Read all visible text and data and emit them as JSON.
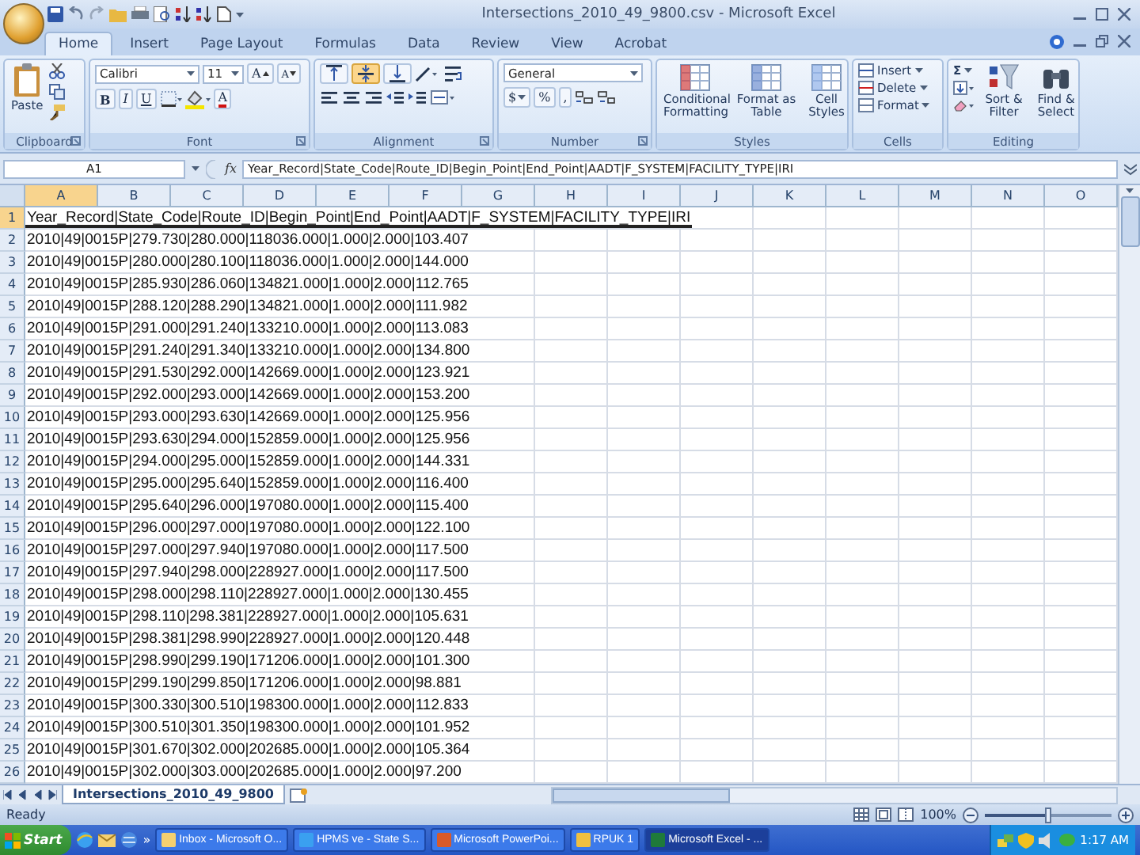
{
  "window": {
    "title": "Intersections_2010_49_9800.csv - Microsoft Excel"
  },
  "tabs": [
    {
      "label": "Home",
      "selected": true
    },
    {
      "label": "Insert",
      "selected": false
    },
    {
      "label": "Page Layout",
      "selected": false
    },
    {
      "label": "Formulas",
      "selected": false
    },
    {
      "label": "Data",
      "selected": false
    },
    {
      "label": "Review",
      "selected": false
    },
    {
      "label": "View",
      "selected": false
    },
    {
      "label": "Acrobat",
      "selected": false
    }
  ],
  "ribbon": {
    "clipboard": {
      "label": "Clipboard",
      "paste": "Paste"
    },
    "font": {
      "label": "Font",
      "name": "Calibri",
      "size": "11",
      "grow": "A",
      "shrink": "A",
      "bold": "B",
      "italic": "I",
      "underline": "U",
      "font_color_label": "A"
    },
    "alignment": {
      "label": "Alignment",
      "vertical_align": [
        {
          "selected": false
        },
        {
          "selected": true
        },
        {
          "selected": false
        }
      ]
    },
    "number": {
      "label": "Number",
      "format": "General",
      "currency": "$",
      "percent": "%",
      "comma": ","
    },
    "styles": {
      "label": "Styles",
      "buttons": [
        "Conditional Formatting",
        "Format as Table",
        "Cell Styles"
      ]
    },
    "cells": {
      "label": "Cells",
      "buttons": [
        "Insert",
        "Delete",
        "Format"
      ]
    },
    "editing": {
      "label": "Editing",
      "sum": "Σ",
      "buttons": [
        "Sort & Filter",
        "Find & Select"
      ]
    }
  },
  "formula_bar": {
    "name_box": "A1",
    "function_label": "fx",
    "formula": "Year_Record|State_Code|Route_ID|Begin_Point|End_Point|AADT|F_SYSTEM|FACILITY_TYPE|IRI"
  },
  "columns": [
    {
      "label": "A",
      "selected": true
    },
    {
      "label": "B",
      "selected": false
    },
    {
      "label": "C",
      "selected": false
    },
    {
      "label": "D",
      "selected": false
    },
    {
      "label": "E",
      "selected": false
    },
    {
      "label": "F",
      "selected": false
    },
    {
      "label": "G",
      "selected": false
    },
    {
      "label": "H",
      "selected": false
    },
    {
      "label": "I",
      "selected": false
    },
    {
      "label": "J",
      "selected": false
    },
    {
      "label": "K",
      "selected": false
    },
    {
      "label": "L",
      "selected": false
    },
    {
      "label": "M",
      "selected": false
    },
    {
      "label": "N",
      "selected": false
    },
    {
      "label": "O",
      "selected": false
    }
  ],
  "rows": [
    {
      "number": "1",
      "text": "Year_Record|State_Code|Route_ID|Begin_Point|End_Point|AADT|F_SYSTEM|FACILITY_TYPE|IRI",
      "selected": true
    },
    {
      "number": "2",
      "text": "2010|49|0015P|279.730|280.000|118036.000|1.000|2.000|103.407",
      "selected": false
    },
    {
      "number": "3",
      "text": "2010|49|0015P|280.000|280.100|118036.000|1.000|2.000|144.000",
      "selected": false
    },
    {
      "number": "4",
      "text": "2010|49|0015P|285.930|286.060|134821.000|1.000|2.000|112.765",
      "selected": false
    },
    {
      "number": "5",
      "text": "2010|49|0015P|288.120|288.290|134821.000|1.000|2.000|111.982",
      "selected": false
    },
    {
      "number": "6",
      "text": "2010|49|0015P|291.000|291.240|133210.000|1.000|2.000|113.083",
      "selected": false
    },
    {
      "number": "7",
      "text": "2010|49|0015P|291.240|291.340|133210.000|1.000|2.000|134.800",
      "selected": false
    },
    {
      "number": "8",
      "text": "2010|49|0015P|291.530|292.000|142669.000|1.000|2.000|123.921",
      "selected": false
    },
    {
      "number": "9",
      "text": "2010|49|0015P|292.000|293.000|142669.000|1.000|2.000|153.200",
      "selected": false
    },
    {
      "number": "10",
      "text": "2010|49|0015P|293.000|293.630|142669.000|1.000|2.000|125.956",
      "selected": false
    },
    {
      "number": "11",
      "text": "2010|49|0015P|293.630|294.000|152859.000|1.000|2.000|125.956",
      "selected": false
    },
    {
      "number": "12",
      "text": "2010|49|0015P|294.000|295.000|152859.000|1.000|2.000|144.331",
      "selected": false
    },
    {
      "number": "13",
      "text": "2010|49|0015P|295.000|295.640|152859.000|1.000|2.000|116.400",
      "selected": false
    },
    {
      "number": "14",
      "text": "2010|49|0015P|295.640|296.000|197080.000|1.000|2.000|115.400",
      "selected": false
    },
    {
      "number": "15",
      "text": "2010|49|0015P|296.000|297.000|197080.000|1.000|2.000|122.100",
      "selected": false
    },
    {
      "number": "16",
      "text": "2010|49|0015P|297.000|297.940|197080.000|1.000|2.000|117.500",
      "selected": false
    },
    {
      "number": "17",
      "text": "2010|49|0015P|297.940|298.000|228927.000|1.000|2.000|117.500",
      "selected": false
    },
    {
      "number": "18",
      "text": "2010|49|0015P|298.000|298.110|228927.000|1.000|2.000|130.455",
      "selected": false
    },
    {
      "number": "19",
      "text": "2010|49|0015P|298.110|298.381|228927.000|1.000|2.000|105.631",
      "selected": false
    },
    {
      "number": "20",
      "text": "2010|49|0015P|298.381|298.990|228927.000|1.000|2.000|120.448",
      "selected": false
    },
    {
      "number": "21",
      "text": "2010|49|0015P|298.990|299.190|171206.000|1.000|2.000|101.300",
      "selected": false
    },
    {
      "number": "22",
      "text": "2010|49|0015P|299.190|299.850|171206.000|1.000|2.000|98.881",
      "selected": false
    },
    {
      "number": "23",
      "text": "2010|49|0015P|300.330|300.510|198300.000|1.000|2.000|112.833",
      "selected": false
    },
    {
      "number": "24",
      "text": "2010|49|0015P|300.510|301.350|198300.000|1.000|2.000|101.952",
      "selected": false
    },
    {
      "number": "25",
      "text": "2010|49|0015P|301.670|302.000|202685.000|1.000|2.000|105.364",
      "selected": false
    },
    {
      "number": "26",
      "text": "2010|49|0015P|302.000|303.000|202685.000|1.000|2.000|97.200",
      "selected": false
    }
  ],
  "sheet_tabs": [
    {
      "label": "Intersections_2010_49_9800",
      "selected": true
    }
  ],
  "status_bar": {
    "status": "Ready",
    "zoom": "100%",
    "zoom_level": {
      "level": 0.5
    }
  },
  "taskbar": {
    "start": "Start",
    "overflow": "»",
    "tasks": [
      {
        "label": "Inbox - Microsoft O...",
        "selected": false
      },
      {
        "label": "HPMS ve - State S...",
        "selected": false
      },
      {
        "label": "Microsoft PowerPoi...",
        "selected": false
      },
      {
        "label": "RPUK 1",
        "selected": false
      },
      {
        "label": "Microsoft Excel - ...",
        "selected": true
      }
    ],
    "clock": "1:17 AM"
  }
}
